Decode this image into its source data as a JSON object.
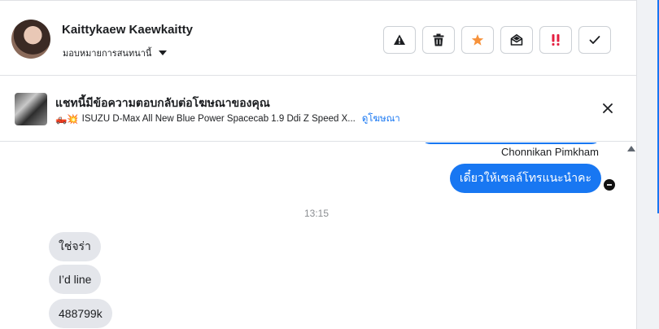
{
  "contact": {
    "name": "Kaittykaew Kaewkaitty",
    "assign_label": "มอบหมายการสนทนานี้"
  },
  "actions": [
    {
      "icon": "warning-icon",
      "color": "#1c1e21"
    },
    {
      "icon": "trash-icon",
      "color": "#1c1e21"
    },
    {
      "icon": "star-icon",
      "color": "#f7923b"
    },
    {
      "icon": "envelope-open-icon",
      "color": "#1c1e21"
    },
    {
      "icon": "priority-icon",
      "color": "#e41e3f"
    },
    {
      "icon": "checkmark-icon",
      "color": "#1c1e21"
    }
  ],
  "ad_banner": {
    "title": "แชทนี้มีข้อความตอบกลับต่อโฆษณาของคุณ",
    "emojis": "🛻💥",
    "ad_name": "ISUZU D-Max All New Blue Power Spacecab 1.9 Ddi Z Speed X...",
    "view_ad_link": "ดูโฆษณา"
  },
  "messages": {
    "outgoing_sender": "Chonnikan Pimkham",
    "outgoing_text": "เดี๋ยวให้เซลล์โทรแนะนำคะ",
    "timestamp": "13:15",
    "incoming": [
      "ใช่จร่า",
      "I’d line",
      "488799k"
    ]
  },
  "colors": {
    "accent": "#1877f2",
    "incoming_bubble": "#e4e6eb",
    "divider": "#dfe1e5"
  }
}
